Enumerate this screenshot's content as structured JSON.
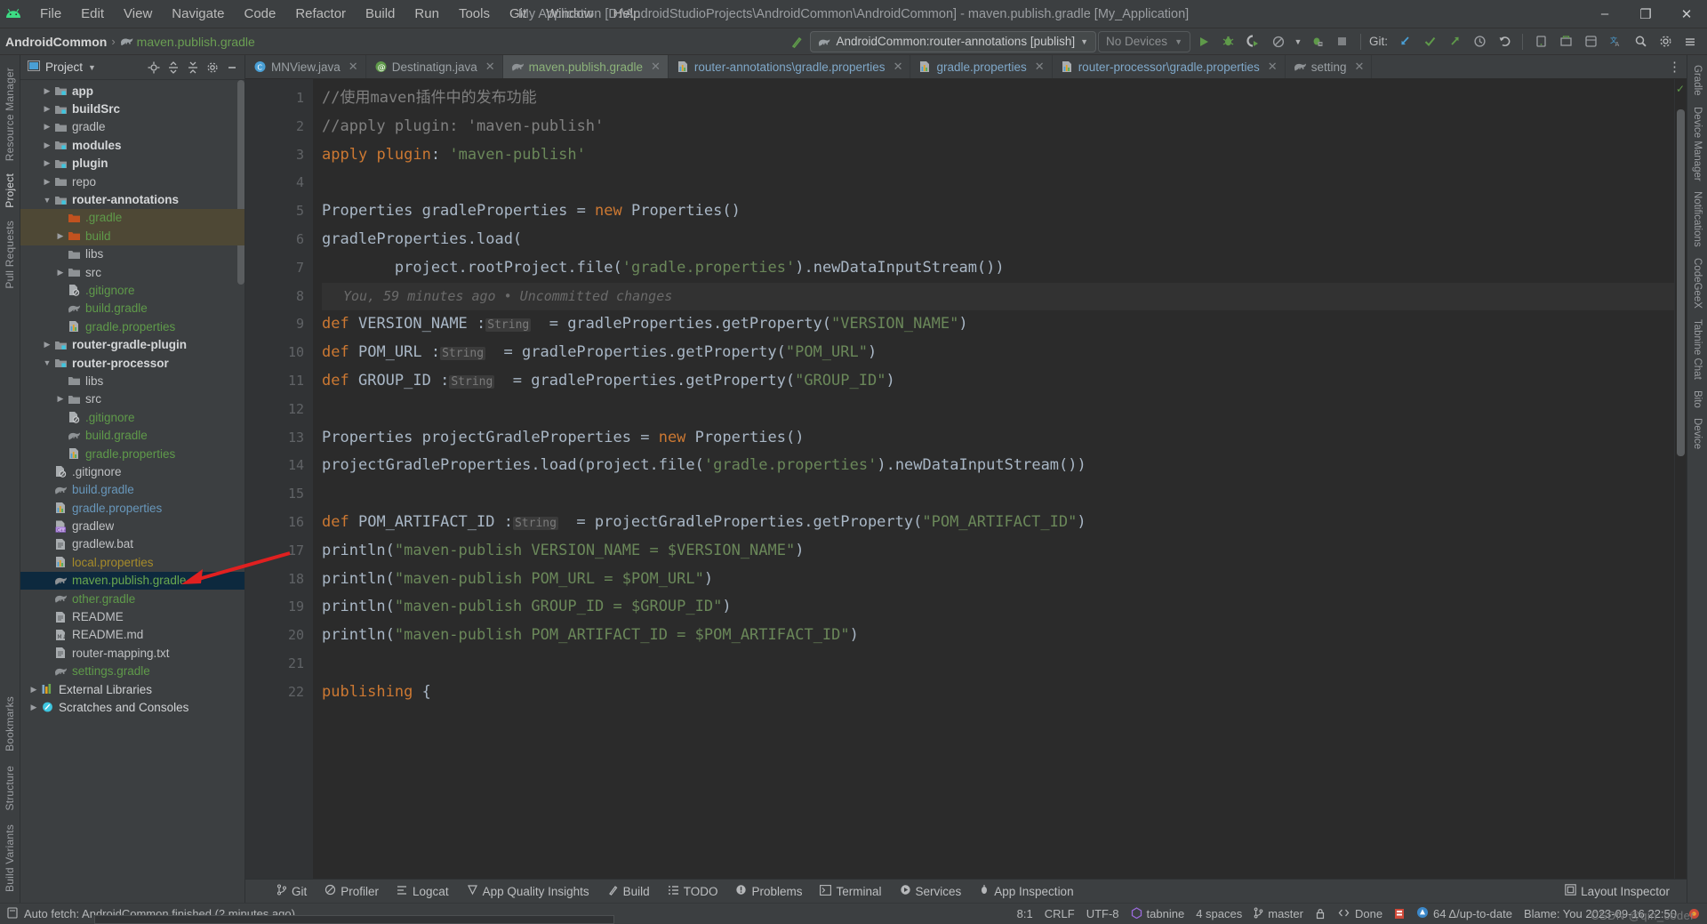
{
  "titlebar": {
    "app_icon": "android-logo-icon",
    "menus": [
      "File",
      "Edit",
      "View",
      "Navigate",
      "Code",
      "Refactor",
      "Build",
      "Run",
      "Tools",
      "Git",
      "Window",
      "Help"
    ],
    "window_title": "My Application [D:\\AndroidStudioProjects\\AndroidCommon\\AndroidCommon] - maven.publish.gradle [My_Application]",
    "minimize": "–",
    "maximize": "❐",
    "close": "✕"
  },
  "navbar": {
    "breadcrumb_project": "AndroidCommon",
    "breadcrumb_sep": "›",
    "breadcrumb_file": "maven.publish.gradle",
    "run_config": "AndroidCommon:router-annotations [publish]",
    "devices": "No Devices",
    "git_label": "Git:",
    "icons": [
      "build-hammer-icon",
      "run-icon",
      "debug-icon",
      "run-coverage-icon",
      "profile-icon",
      "attach-debugger-icon",
      "stop-icon",
      "git-update-icon",
      "git-commit-icon",
      "git-push-icon",
      "history-icon",
      "undo-icon",
      "avd-manager-icon",
      "sdk-manager-icon",
      "device-file-explorer-icon",
      "translate-icon",
      "search-everywhere-icon",
      "settings-icon",
      "hamburger-icon"
    ]
  },
  "left_rail": {
    "items": [
      "Resource Manager",
      "Project",
      "Pull Requests"
    ],
    "selected": "Project",
    "bottom_items": [
      "Bookmarks",
      "Structure",
      "Build Variants"
    ]
  },
  "right_rail": {
    "items": [
      "Gradle",
      "Device Manager",
      "Notifications",
      "CodeGeeX",
      "Tabnine Chat",
      "Bito",
      "Device"
    ]
  },
  "project_panel": {
    "title": "Project",
    "header_icons": [
      "project-dropdown-icon",
      "locate-icon",
      "expand-all-icon",
      "collapse-all-icon",
      "settings-icon",
      "hide-icon"
    ],
    "tree": [
      {
        "label": "app",
        "indent": 1,
        "arrow": "right",
        "icon": "module-folder-icon",
        "style": "bold"
      },
      {
        "label": "buildSrc",
        "indent": 1,
        "arrow": "right",
        "icon": "module-folder-icon",
        "style": "bold"
      },
      {
        "label": "gradle",
        "indent": 1,
        "arrow": "right",
        "icon": "folder-icon",
        "style": "plain"
      },
      {
        "label": "modules",
        "indent": 1,
        "arrow": "right",
        "icon": "module-folder-icon",
        "style": "bold"
      },
      {
        "label": "plugin",
        "indent": 1,
        "arrow": "right",
        "icon": "module-folder-icon",
        "style": "bold"
      },
      {
        "label": "repo",
        "indent": 1,
        "arrow": "right",
        "icon": "folder-icon",
        "style": "plain"
      },
      {
        "label": "router-annotations",
        "indent": 1,
        "arrow": "down",
        "icon": "module-folder-icon",
        "style": "bold"
      },
      {
        "label": ".gradle",
        "indent": 2,
        "arrow": "none",
        "icon": "excluded-folder-icon",
        "style": "green",
        "row": "highlight"
      },
      {
        "label": "build",
        "indent": 2,
        "arrow": "right",
        "icon": "excluded-folder-icon",
        "style": "green",
        "row": "highlight"
      },
      {
        "label": "libs",
        "indent": 2,
        "arrow": "none",
        "icon": "folder-icon",
        "style": "plain"
      },
      {
        "label": "src",
        "indent": 2,
        "arrow": "right",
        "icon": "folder-icon",
        "style": "plain"
      },
      {
        "label": ".gitignore",
        "indent": 2,
        "arrow": "none",
        "icon": "gitignore-file-icon",
        "style": "green"
      },
      {
        "label": "build.gradle",
        "indent": 2,
        "arrow": "none",
        "icon": "gradle-file-icon",
        "style": "green"
      },
      {
        "label": "gradle.properties",
        "indent": 2,
        "arrow": "none",
        "icon": "properties-file-icon",
        "style": "green"
      },
      {
        "label": "router-gradle-plugin",
        "indent": 1,
        "arrow": "right",
        "icon": "module-folder-icon",
        "style": "bold"
      },
      {
        "label": "router-processor",
        "indent": 1,
        "arrow": "down",
        "icon": "module-folder-icon",
        "style": "bold"
      },
      {
        "label": "libs",
        "indent": 2,
        "arrow": "none",
        "icon": "folder-icon",
        "style": "plain"
      },
      {
        "label": "src",
        "indent": 2,
        "arrow": "right",
        "icon": "folder-icon",
        "style": "plain"
      },
      {
        "label": ".gitignore",
        "indent": 2,
        "arrow": "none",
        "icon": "gitignore-file-icon",
        "style": "green"
      },
      {
        "label": "build.gradle",
        "indent": 2,
        "arrow": "none",
        "icon": "gradle-file-icon",
        "style": "green"
      },
      {
        "label": "gradle.properties",
        "indent": 2,
        "arrow": "none",
        "icon": "properties-file-icon",
        "style": "green"
      },
      {
        "label": ".gitignore",
        "indent": 1,
        "arrow": "none",
        "icon": "gitignore-file-icon",
        "style": "plain"
      },
      {
        "label": "build.gradle",
        "indent": 1,
        "arrow": "none",
        "icon": "gradle-file-icon",
        "style": "blue"
      },
      {
        "label": "gradle.properties",
        "indent": 1,
        "arrow": "none",
        "icon": "properties-file-icon",
        "style": "blue"
      },
      {
        "label": "gradlew",
        "indent": 1,
        "arrow": "none",
        "icon": "cpp-file-icon",
        "style": "plain"
      },
      {
        "label": "gradlew.bat",
        "indent": 1,
        "arrow": "none",
        "icon": "text-file-icon",
        "style": "plain"
      },
      {
        "label": "local.properties",
        "indent": 1,
        "arrow": "none",
        "icon": "properties-file-icon",
        "style": "gold"
      },
      {
        "label": "maven.publish.gradle",
        "indent": 1,
        "arrow": "none",
        "icon": "gradle-file-icon",
        "style": "greenbr",
        "row": "selected"
      },
      {
        "label": "other.gradle",
        "indent": 1,
        "arrow": "none",
        "icon": "gradle-file-icon",
        "style": "green"
      },
      {
        "label": "README",
        "indent": 1,
        "arrow": "none",
        "icon": "text-file-icon",
        "style": "plain"
      },
      {
        "label": "README.md",
        "indent": 1,
        "arrow": "none",
        "icon": "markdown-file-icon",
        "style": "plain"
      },
      {
        "label": "router-mapping.txt",
        "indent": 1,
        "arrow": "none",
        "icon": "text-file-icon",
        "style": "plain"
      },
      {
        "label": "settings.gradle",
        "indent": 1,
        "arrow": "none",
        "icon": "gradle-file-icon",
        "style": "green"
      },
      {
        "label": "External Libraries",
        "indent": 0,
        "arrow": "right",
        "icon": "library-icon",
        "style": "white"
      },
      {
        "label": "Scratches and Consoles",
        "indent": 0,
        "arrow": "right",
        "icon": "scratches-icon",
        "style": "white"
      }
    ]
  },
  "editor": {
    "tabs": [
      {
        "label": "MNView.java",
        "icon": "java-class-icon",
        "active": false
      },
      {
        "label": "Destinatign.java",
        "icon": "annotation-icon",
        "active": false
      },
      {
        "label": "maven.publish.gradle",
        "icon": "gradle-file-icon",
        "active": true
      },
      {
        "label": "router-annotations\\gradle.properties",
        "icon": "properties-file-icon",
        "active": false
      },
      {
        "label": "gradle.properties",
        "icon": "properties-file-icon",
        "active": false
      },
      {
        "label": "router-processor\\gradle.properties",
        "icon": "properties-file-icon",
        "active": false
      },
      {
        "label": "setting",
        "icon": "gradle-file-icon",
        "active": false
      }
    ],
    "tab_close": "✕",
    "more_tabs": "⋮",
    "line_numbers": [
      "1",
      "2",
      "3",
      "4",
      "5",
      "6",
      "7",
      "8",
      "9",
      "10",
      "11",
      "12",
      "13",
      "14",
      "15",
      "16",
      "17",
      "18",
      "19",
      "20",
      "21",
      "22"
    ],
    "blame_hint": "You, 59 minutes ago • Uncommitted changes",
    "code_lines": [
      "//使用maven插件中的发布功能",
      "//apply plugin: 'maven-publish'",
      "apply plugin: 'maven-publish'",
      "",
      "Properties gradleProperties = new Properties()",
      "gradleProperties.load(",
      "        project.rootProject.file('gradle.properties').newDataInputStream())",
      "",
      "def VERSION_NAME :String  = gradleProperties.getProperty(\"VERSION_NAME\")",
      "def POM_URL :String  = gradleProperties.getProperty(\"POM_URL\")",
      "def GROUP_ID :String  = gradleProperties.getProperty(\"GROUP_ID\")",
      "",
      "Properties projectGradleProperties = new Properties()",
      "projectGradleProperties.load(project.file('gradle.properties').newDataInputStream())",
      "",
      "def POM_ARTIFACT_ID :String  = projectGradleProperties.getProperty(\"POM_ARTIFACT_ID\")",
      "println(\"maven-publish VERSION_NAME = $VERSION_NAME\")",
      "println(\"maven-publish POM_URL = $POM_URL\")",
      "println(\"maven-publish GROUP_ID = $GROUP_ID\")",
      "println(\"maven-publish POM_ARTIFACT_ID = $POM_ARTIFACT_ID\")",
      "",
      "publishing {"
    ]
  },
  "bottom_toolwindows": {
    "items": [
      {
        "label": "Git",
        "icon": "git-branch-icon"
      },
      {
        "label": "Profiler",
        "icon": "profiler-icon"
      },
      {
        "label": "Logcat",
        "icon": "logcat-icon"
      },
      {
        "label": "App Quality Insights",
        "icon": "quality-insights-icon"
      },
      {
        "label": "Build",
        "icon": "build-hammer-icon"
      },
      {
        "label": "TODO",
        "icon": "todo-list-icon"
      },
      {
        "label": "Problems",
        "icon": "problems-icon"
      },
      {
        "label": "Terminal",
        "icon": "terminal-icon"
      },
      {
        "label": "Services",
        "icon": "services-icon"
      },
      {
        "label": "App Inspection",
        "icon": "app-inspection-icon"
      }
    ],
    "right_label": "Layout Inspector",
    "right_icon": "layout-inspector-icon"
  },
  "statusbar": {
    "message": "Auto fetch: AndroidCommon finished (2 minutes ago)",
    "message_icon": "event-log-icon",
    "caret_position": "8:1",
    "line_separator": "CRLF",
    "encoding": "UTF-8",
    "plugin": "tabnine",
    "indent": "4 spaces",
    "branch": "master",
    "branch_icon": "git-branch-icon",
    "lock_icon": "read-only-lock-icon",
    "inspection_label": "Done",
    "inspection_icon": "inspections-icon",
    "memory_icon": "memory-indicator-icon",
    "gradle_status": "64 Δ/up-to-date",
    "gradle_status_icon": "gradle-sync-icon",
    "blame": "Blame: You 2023-09-16 22:50",
    "watermark": "CSDN @qin_coder"
  },
  "colors": {
    "accent_green": "#5f9a4a",
    "string_green": "#6a8759",
    "keyword_orange": "#cc7832",
    "number_blue": "#6897bb",
    "selection_blue": "#0d293e",
    "editor_bg": "#2b2b2b",
    "chrome_bg": "#3c3f41",
    "annotation_red": "#e02020"
  }
}
